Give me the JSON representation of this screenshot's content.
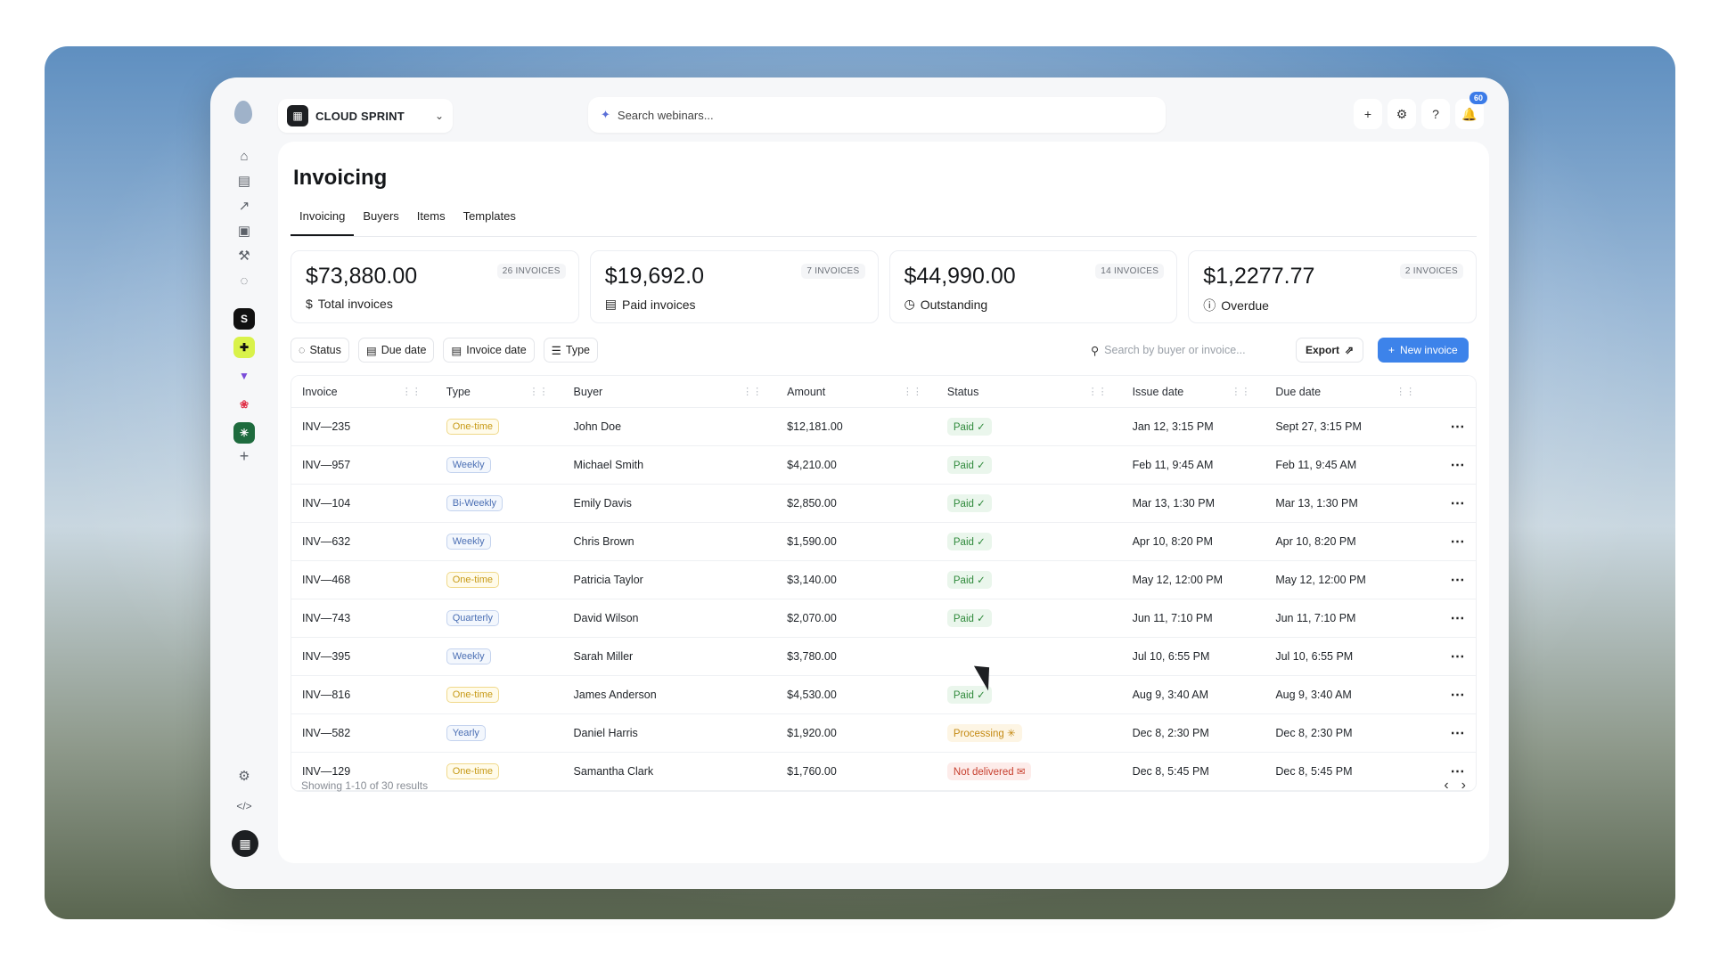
{
  "workspace": {
    "name": "CLOUD SPRINT"
  },
  "search": {
    "placeholder": "Search webinars..."
  },
  "notifications": {
    "count": "60"
  },
  "page": {
    "title": "Invoicing",
    "tabs": [
      "Invoicing",
      "Buyers",
      "Items",
      "Templates"
    ]
  },
  "stats": [
    {
      "amount": "$73,880.00",
      "label": "Total invoices",
      "count": "26 INVOICES",
      "icon": "dollar-icon"
    },
    {
      "amount": "$19,692.0",
      "label": "Paid invoices",
      "count": "7 INVOICES",
      "icon": "receipt-icon"
    },
    {
      "amount": "$44,990.00",
      "label": "Outstanding",
      "count": "14 INVOICES",
      "icon": "clock-icon"
    },
    {
      "amount": "$1,2277.77",
      "label": "Overdue",
      "count": "2 INVOICES",
      "icon": "alert-icon"
    }
  ],
  "filters": {
    "status": "Status",
    "due_date": "Due date",
    "invoice_date": "Invoice date",
    "type": "Type",
    "search_placeholder": "Search by buyer or invoice...",
    "export": "Export",
    "new_invoice": "New invoice"
  },
  "table": {
    "columns": [
      "Invoice",
      "Type",
      "Buyer",
      "Amount",
      "Status",
      "Issue date",
      "Due date"
    ],
    "rows": [
      {
        "invoice": "INV—235",
        "type": "One-time",
        "type_class": "p-onetime",
        "buyer": "John Doe",
        "amount": "$12,181.00",
        "status": "Paid ✓",
        "status_class": "s-paid",
        "issue": "Jan 12, 3:15 PM",
        "due": "Sept 27, 3:15 PM"
      },
      {
        "invoice": "INV—957",
        "type": "Weekly",
        "type_class": "p-weekly",
        "buyer": "Michael Smith",
        "amount": "$4,210.00",
        "status": "Paid ✓",
        "status_class": "s-paid",
        "issue": "Feb 11, 9:45 AM",
        "due": "Feb 11, 9:45 AM"
      },
      {
        "invoice": "INV—104",
        "type": "Bi-Weekly",
        "type_class": "p-biweekly",
        "buyer": "Emily Davis",
        "amount": "$2,850.00",
        "status": "Paid ✓",
        "status_class": "s-paid",
        "issue": "Mar 13, 1:30 PM",
        "due": "Mar 13, 1:30 PM"
      },
      {
        "invoice": "INV—632",
        "type": "Weekly",
        "type_class": "p-weekly",
        "buyer": "Chris Brown",
        "amount": "$1,590.00",
        "status": "Paid ✓",
        "status_class": "s-paid",
        "issue": "Apr 10, 8:20 PM",
        "due": "Apr 10, 8:20 PM"
      },
      {
        "invoice": "INV—468",
        "type": "One-time",
        "type_class": "p-onetime",
        "buyer": "Patricia Taylor",
        "amount": "$3,140.00",
        "status": "Paid ✓",
        "status_class": "s-paid",
        "issue": "May 12, 12:00 PM",
        "due": "May 12, 12:00 PM"
      },
      {
        "invoice": "INV—743",
        "type": "Quarterly",
        "type_class": "p-quarterly",
        "buyer": "David Wilson",
        "amount": "$2,070.00",
        "status": "Paid ✓",
        "status_class": "s-paid",
        "issue": "Jun 11, 7:10 PM",
        "due": "Jun 11, 7:10 PM"
      },
      {
        "invoice": "INV—395",
        "type": "Weekly",
        "type_class": "p-weekly",
        "buyer": "Sarah Miller",
        "amount": "$3,780.00",
        "status": "",
        "status_class": "s-blank",
        "issue": "Jul 10, 6:55 PM",
        "due": "Jul 10, 6:55 PM"
      },
      {
        "invoice": "INV—816",
        "type": "One-time",
        "type_class": "p-onetime",
        "buyer": "James Anderson",
        "amount": "$4,530.00",
        "status": "Paid ✓",
        "status_class": "s-paid",
        "issue": "Aug 9, 3:40 AM",
        "due": "Aug 9, 3:40 AM"
      },
      {
        "invoice": "INV—582",
        "type": "Yearly",
        "type_class": "p-yearly",
        "buyer": "Daniel Harris",
        "amount": "$1,920.00",
        "status": "Processing ✳",
        "status_class": "s-processing",
        "issue": "Dec 8, 2:30 PM",
        "due": "Dec 8, 2:30 PM"
      },
      {
        "invoice": "INV—129",
        "type": "One-time",
        "type_class": "p-onetime",
        "buyer": "Samantha Clark",
        "amount": "$1,760.00",
        "status": "Not delivered ✉",
        "status_class": "s-notdelivered",
        "issue": "Dec 8, 5:45 PM",
        "due": "Dec 8, 5:45 PM"
      }
    ],
    "footer": "Showing 1-10 of 30 results"
  },
  "colors": {
    "accent": "#3d83ea",
    "paid": "#2f8a3b",
    "processing": "#c48a14",
    "not_delivered": "#c7402f"
  }
}
